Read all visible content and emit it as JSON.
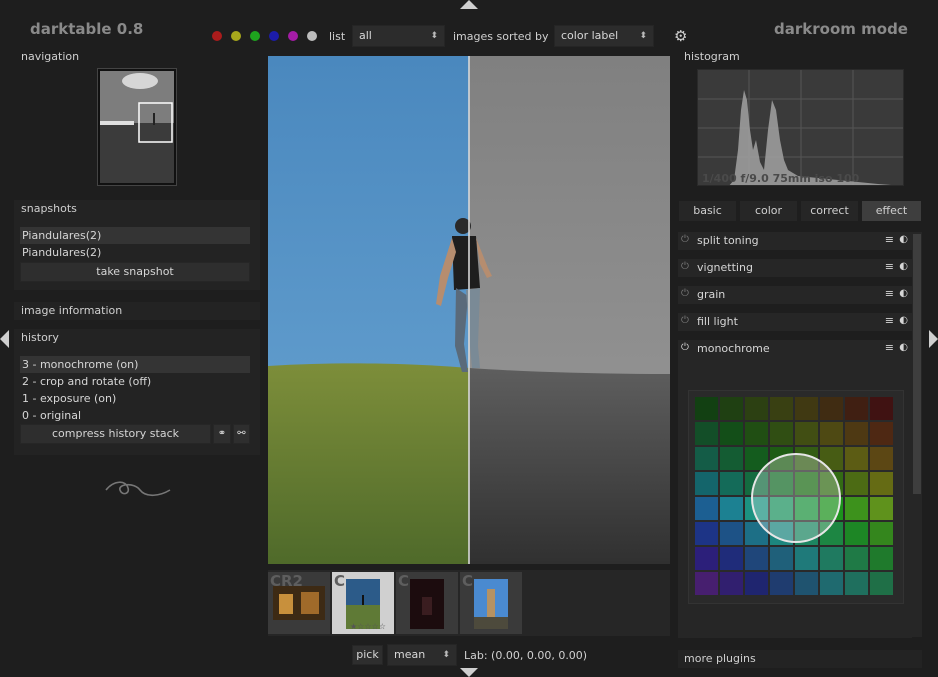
{
  "header": {
    "app_title": "darktable 0.8",
    "mode_title": "darkroom mode",
    "list_label": "list",
    "list_value": "all",
    "sort_label": "images sorted by",
    "sort_value": "color label",
    "color_labels": [
      "#aa1c1c",
      "#a7a71c",
      "#1ea31e",
      "#1c1ca9",
      "#a41ca6",
      "#bdbdbd"
    ]
  },
  "left": {
    "navigation_title": "navigation",
    "snapshots_title": "snapshots",
    "snapshots": [
      "Piandulares(2)",
      "Piandulares(2)"
    ],
    "take_snapshot": "take snapshot",
    "image_information_title": "image information",
    "history_title": "history",
    "history": [
      "3 - monochrome (on)",
      "2 - crop and rotate (off)",
      "1 - exposure (on)",
      "0 - original"
    ],
    "compress_history": "compress history stack"
  },
  "center": {
    "filmstrip_labels": [
      "CR2",
      "C",
      "C",
      "C"
    ],
    "rating_stars": "★☆☆☆☆",
    "pick_label": "pick",
    "mean_value": "mean",
    "lab_readout": "Lab: (0.00, 0.00, 0.00)"
  },
  "right": {
    "histogram_title": "histogram",
    "exif_overlay": "1/400 f/9.0 75mm iso 100",
    "tabs": [
      "basic",
      "color",
      "correct",
      "effect"
    ],
    "active_tab": "effect",
    "plugins": [
      "split toning",
      "vignetting",
      "grain",
      "fill light",
      "monochrome"
    ],
    "more_plugins": "more plugins"
  },
  "icons": {
    "settings": "gear-icon",
    "power": "power-icon",
    "menu": "hamburger-menu-icon",
    "preset": "preset-icon"
  }
}
